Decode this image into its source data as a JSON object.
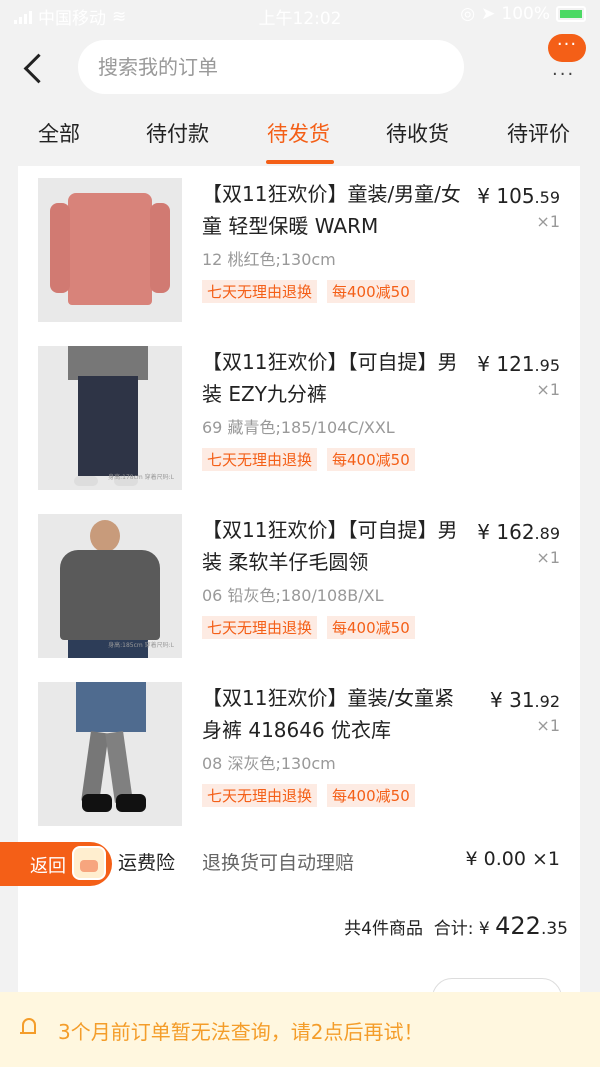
{
  "status_bar": {
    "carrier": "中国移动",
    "time": "上午12:02",
    "battery": "100%"
  },
  "header": {
    "search_placeholder": "搜索我的订单",
    "menu_icon": "more-dots",
    "menu_bubble": "···"
  },
  "tabs": [
    {
      "label": "全部"
    },
    {
      "label": "待付款"
    },
    {
      "label": "待发货",
      "active": true
    },
    {
      "label": "待收货"
    },
    {
      "label": "待评价"
    }
  ],
  "items": [
    {
      "title": "【双11狂欢价】童装/男童/女童 轻型保暖 WARM",
      "spec": "12 桃红色;130cm",
      "tags": [
        "七天无理由退换",
        "每400减50"
      ],
      "price_int": "¥ 105",
      "price_dec": ".59",
      "qty": "×1"
    },
    {
      "title": "【双11狂欢价】【可自提】男装 EZY九分裤",
      "spec": "69 藏青色;185/104C/XXL",
      "tags": [
        "七天无理由退换",
        "每400减50"
      ],
      "price_int": "¥ 121",
      "price_dec": ".95",
      "qty": "×1",
      "image_caption": "身高:178cm 穿着尺码:L"
    },
    {
      "title": "【双11狂欢价】【可自提】男装 柔软羊仔毛圆领",
      "spec": "06 铅灰色;180/108B/XL",
      "tags": [
        "七天无理由退换",
        "每400减50"
      ],
      "price_int": "¥ 162",
      "price_dec": ".89",
      "qty": "×1",
      "image_caption": "身高:185cm 穿着尺码:L"
    },
    {
      "title": "【双11狂欢价】童装/女童紧身裤 418646 优衣库",
      "spec": "08 深灰色;130cm",
      "tags": [
        "七天无理由退换",
        "每400减50"
      ],
      "price_int": "¥ 31",
      "price_dec": ".92",
      "qty": "×1"
    }
  ],
  "insurance": {
    "label": "运费险",
    "desc": "退换货可自动理赔",
    "price": "¥ 0.00 ×1"
  },
  "summary": {
    "count_label": "共4件商品",
    "total_label": "合计: ¥",
    "total_int": "422",
    "total_dec": ".35"
  },
  "back_float": {
    "label": "返回"
  },
  "notice": {
    "text": "3个月前订单暂无法查询，请2点后再试！"
  },
  "colors": {
    "accent": "#f45f17",
    "notice_bg": "#fff7df",
    "notice_text": "#f49d2a"
  }
}
